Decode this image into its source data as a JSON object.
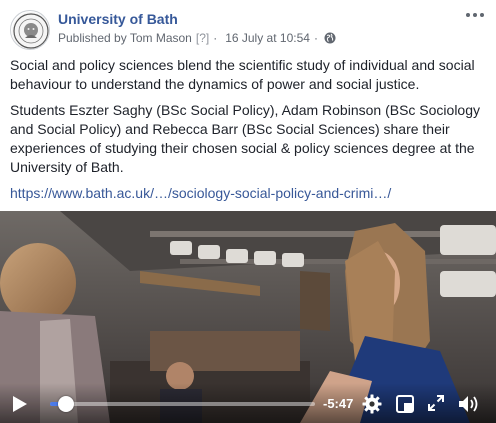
{
  "post": {
    "page_name": "University of Bath",
    "published_by": "Published by Tom Mason",
    "help_marker": "[?]",
    "separator": "·",
    "timestamp": "16 July at 10:54",
    "audience_icon": "globe-icon",
    "more_icon": "more-options-icon",
    "paragraphs": [
      "Social and policy sciences blend the scientific study of individual and social behaviour to understand the dynamics of power and social justice.",
      "Students Eszter Saghy (BSc Social Policy), Adam Robinson (BSc Sociology and Social Policy) and Rebecca Barr (BSc Social Sciences) share their experiences of studying their chosen social & policy sciences degree at the University of Bath."
    ],
    "link_text": "https://www.bath.ac.uk/…/sociology-social-policy-and-crimi…/"
  },
  "video": {
    "remaining_time": "-5:47",
    "progress": 0.06,
    "icons": {
      "play": "play-icon",
      "settings": "gear-icon",
      "pip": "picture-in-picture-icon",
      "fullscreen": "fullscreen-icon",
      "volume": "volume-icon"
    }
  },
  "colors": {
    "page_name": "#365899",
    "link": "#385898",
    "meta": "#616770",
    "progress": "#4c7be8"
  }
}
